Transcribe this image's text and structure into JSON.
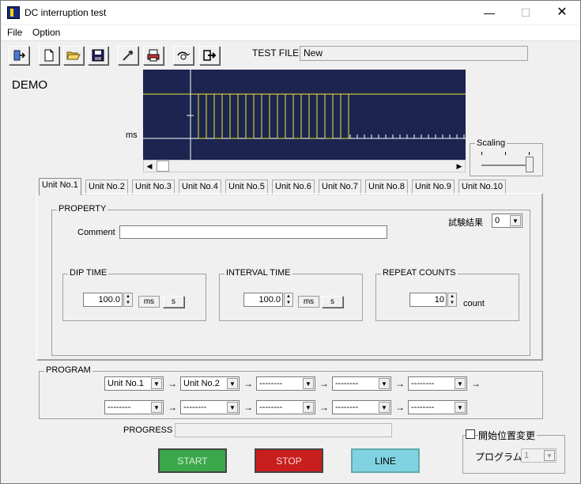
{
  "window": {
    "title": "DC interruption test",
    "minimize": "—",
    "maximize": "☐",
    "close": "✕"
  },
  "menu": {
    "file": "File",
    "option": "Option"
  },
  "toolbar": {
    "exit_icon": "exit-icon",
    "new_icon": "new-file-icon",
    "open_icon": "open-folder-icon",
    "save_icon": "save-icon",
    "settings_icon": "tools-icon",
    "print_icon": "print-icon",
    "connect_icon": "connect-icon",
    "logout_icon": "logout-icon"
  },
  "test_file": {
    "label": "TEST FILE",
    "value": "New"
  },
  "demo_label": "DEMO",
  "scope": {
    "unit_label": "ms",
    "bg_color": "#1b2550",
    "trace_color": "#f5e23a",
    "pulse_count": 10
  },
  "scaling": {
    "label": "Scaling"
  },
  "tabs": [
    {
      "label": "Unit No.1"
    },
    {
      "label": "Unit No.2"
    },
    {
      "label": "Unit No.3"
    },
    {
      "label": "Unit No.4"
    },
    {
      "label": "Unit No.5"
    },
    {
      "label": "Unit No.6"
    },
    {
      "label": "Unit No.7"
    },
    {
      "label": "Unit No.8"
    },
    {
      "label": "Unit No.9"
    },
    {
      "label": "Unit No.10"
    }
  ],
  "property": {
    "legend": "PROPERTY",
    "comment_label": "Comment",
    "comment_value": "",
    "result_label": "試験結果",
    "result_value": "0",
    "dip_time": {
      "legend": "DIP TIME",
      "value": "100.0",
      "unit": "ms",
      "unit_alt": "s"
    },
    "interval_time": {
      "legend": "INTERVAL TIME",
      "value": "100.0",
      "unit": "ms",
      "unit_alt": "s"
    },
    "repeat_counts": {
      "legend": "REPEAT COUNTS",
      "value": "10",
      "unit": "count"
    }
  },
  "program": {
    "legend": "PROGRAM",
    "row1": [
      "Unit No.1",
      "Unit No.2",
      "--------",
      "--------",
      "--------"
    ],
    "row2": [
      "--------",
      "--------",
      "--------",
      "--------",
      "--------"
    ]
  },
  "progress": {
    "label": "PROGRESS"
  },
  "buttons": {
    "start": "START",
    "stop": "STOP",
    "line": "LINE",
    "start_color": "#3aa84a",
    "stop_color": "#c81e1e",
    "line_color": "#7fd3e0"
  },
  "start_position": {
    "checkbox_label": "開始位置変更",
    "program_label": "プログラム",
    "program_value": "1"
  }
}
